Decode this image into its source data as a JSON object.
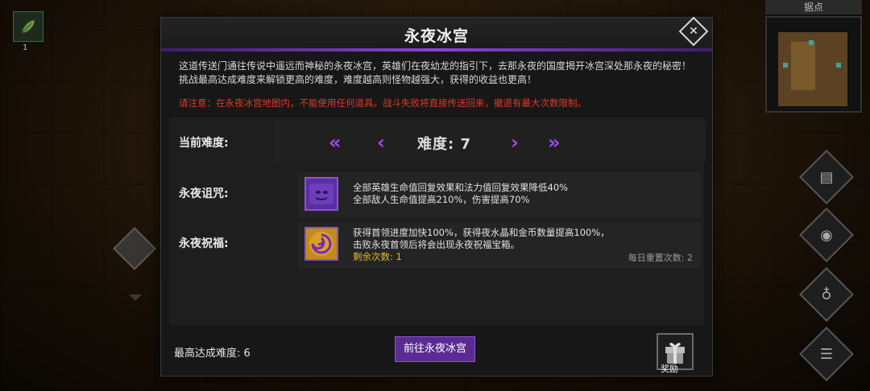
{
  "hud": {
    "item_count": "1",
    "minimap_title": "据点"
  },
  "dialog": {
    "title": "永夜冰宫",
    "description_line1": "这道传送门通往传说中遥远而神秘的永夜冰宫，英雄们在夜幼龙的指引下，去那永夜的国度揭开冰宫深处那永夜的秘密！",
    "description_line2": "挑战最高达成难度来解锁更高的难度，难度越高则怪物越强大，获得的收益也更高！",
    "warning": "请注意：在永夜冰宫地图内，不能使用任何道具。战斗失败将直接传送回来，撤退有最大次数限制。",
    "difficulty": {
      "label": "当前难度:",
      "value_text": "难度: 7",
      "prev_far": "«",
      "prev": "‹",
      "next": "›",
      "next_far": "»"
    },
    "curse": {
      "label": "永夜诅咒:",
      "line1": "全部英雄生命值回复效果和法力值回复效果降低40%",
      "line2": "全部敌人生命值提高210%，伤害提高70%"
    },
    "blessing": {
      "label": "永夜祝福:",
      "line1": "获得首领进度加快100%，获得夜水晶和金币数量提高100%，",
      "line2": "击败永夜首领后将会出现永夜祝福宝箱。",
      "remaining": "剩余次数: 1",
      "daily_reset": "每日重置次数: 2"
    },
    "max_difficulty": "最高达成难度: 6",
    "go_button": "前往永夜冰宫",
    "reward_label": "奖励"
  },
  "colors": {
    "accent": "#8a44d6",
    "warning": "#e03a2a",
    "remaining": "#e8b830"
  }
}
